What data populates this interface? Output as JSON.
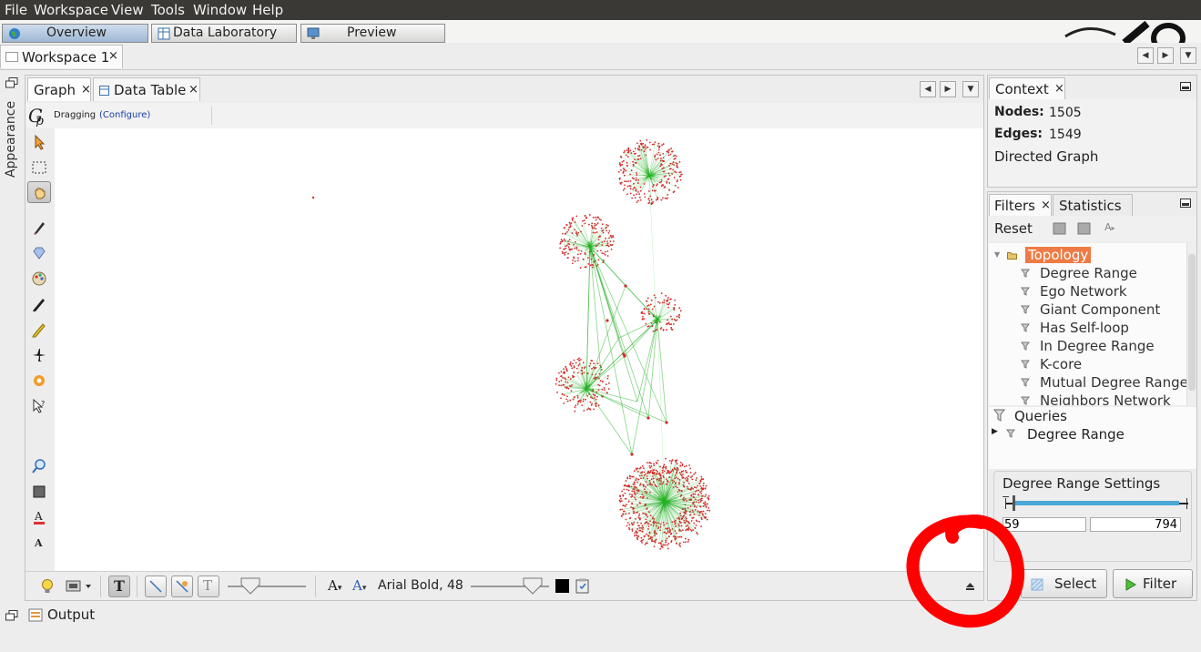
{
  "menu": {
    "file": "File",
    "workspace": "Workspace",
    "view": "View",
    "tools": "Tools",
    "window": "Window",
    "help": "Help"
  },
  "perspectives": {
    "overview": "Overview",
    "data_laboratory": "Data Laboratory",
    "preview": "Preview"
  },
  "workspace_tab": {
    "label": "Workspace 1",
    "close": "×"
  },
  "left_strip": {
    "appearance": "Appearance"
  },
  "graph_panel": {
    "tab_graph": "Graph",
    "tab_data_table": "Data Table",
    "close": "×",
    "mode_label": "Dragging",
    "configure_link": "(Configure)",
    "font_label": "Arial Bold, 48"
  },
  "context": {
    "tab": "Context",
    "close": "×",
    "nodes_label": "Nodes:",
    "nodes_value": "1505",
    "edges_label": "Edges:",
    "edges_value": "1549",
    "graph_type": "Directed Graph"
  },
  "filters": {
    "tab_filters": "Filters",
    "close": "×",
    "tab_statistics": "Statistics",
    "reset": "Reset",
    "topology": "Topology",
    "items": [
      "Degree Range",
      "Ego Network",
      "Giant Component",
      "Has Self-loop",
      "In Degree Range",
      "K-core",
      "Mutual Degree Range",
      "Neighbors Network"
    ],
    "queries_label": "Queries",
    "query_item": "Degree Range",
    "settings_title": "Degree Range Settings",
    "range_min": "59",
    "range_max": "794",
    "select_button": "Select",
    "filter_button": "Filter"
  },
  "output": {
    "label": "Output"
  },
  "colors": {
    "menubar": "#3a3935",
    "node_red": "#d42a2a",
    "edge_green": "#22b022",
    "topology_highlight": "#ee7b45",
    "annotation_red": "#ff0000",
    "slider_blue": "#4aa7d6"
  }
}
